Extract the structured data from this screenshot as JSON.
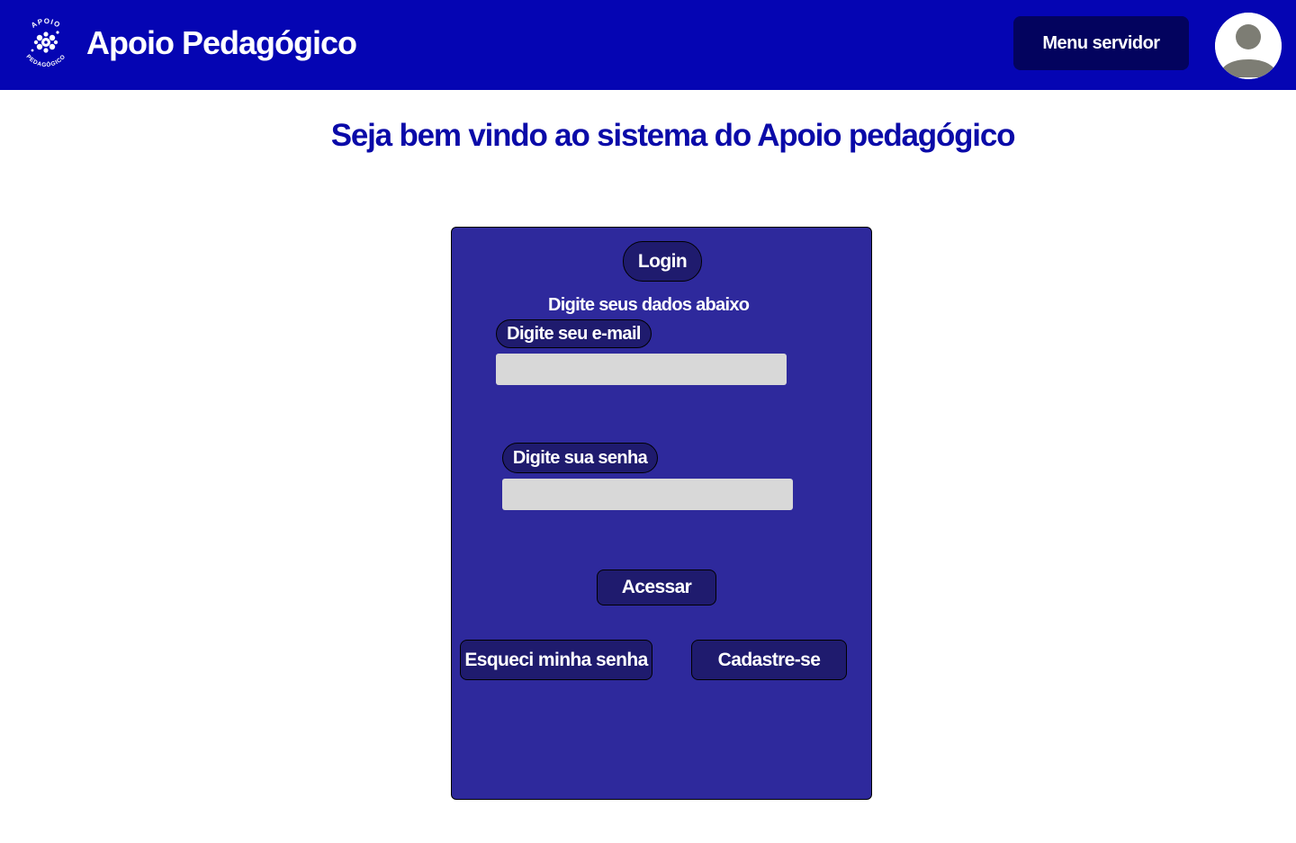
{
  "header": {
    "brand_title": "Apoio Pedagógico",
    "logo_text_top": "APOIO",
    "logo_text_bottom": "PEDAGÓGICO",
    "menu_button_label": "Menu servidor",
    "background_color": "#0505b3"
  },
  "main": {
    "welcome_title": "Seja bem vindo ao sistema do Apoio pedagógico"
  },
  "login_panel": {
    "title": "Login",
    "subtitle": "Digite seus dados abaixo",
    "email_label": "Digite seu e-mail",
    "email_value": "",
    "password_label": "Digite sua senha",
    "password_value": "",
    "submit_label": "Acessar",
    "forgot_label": "Esqueci minha senha",
    "signup_label": "Cadastre-se",
    "panel_color": "#2e299c",
    "button_color": "#1f1b6e"
  },
  "icons": {
    "logo": "apoio-pedagogico-logo",
    "avatar": "user-avatar-icon"
  }
}
